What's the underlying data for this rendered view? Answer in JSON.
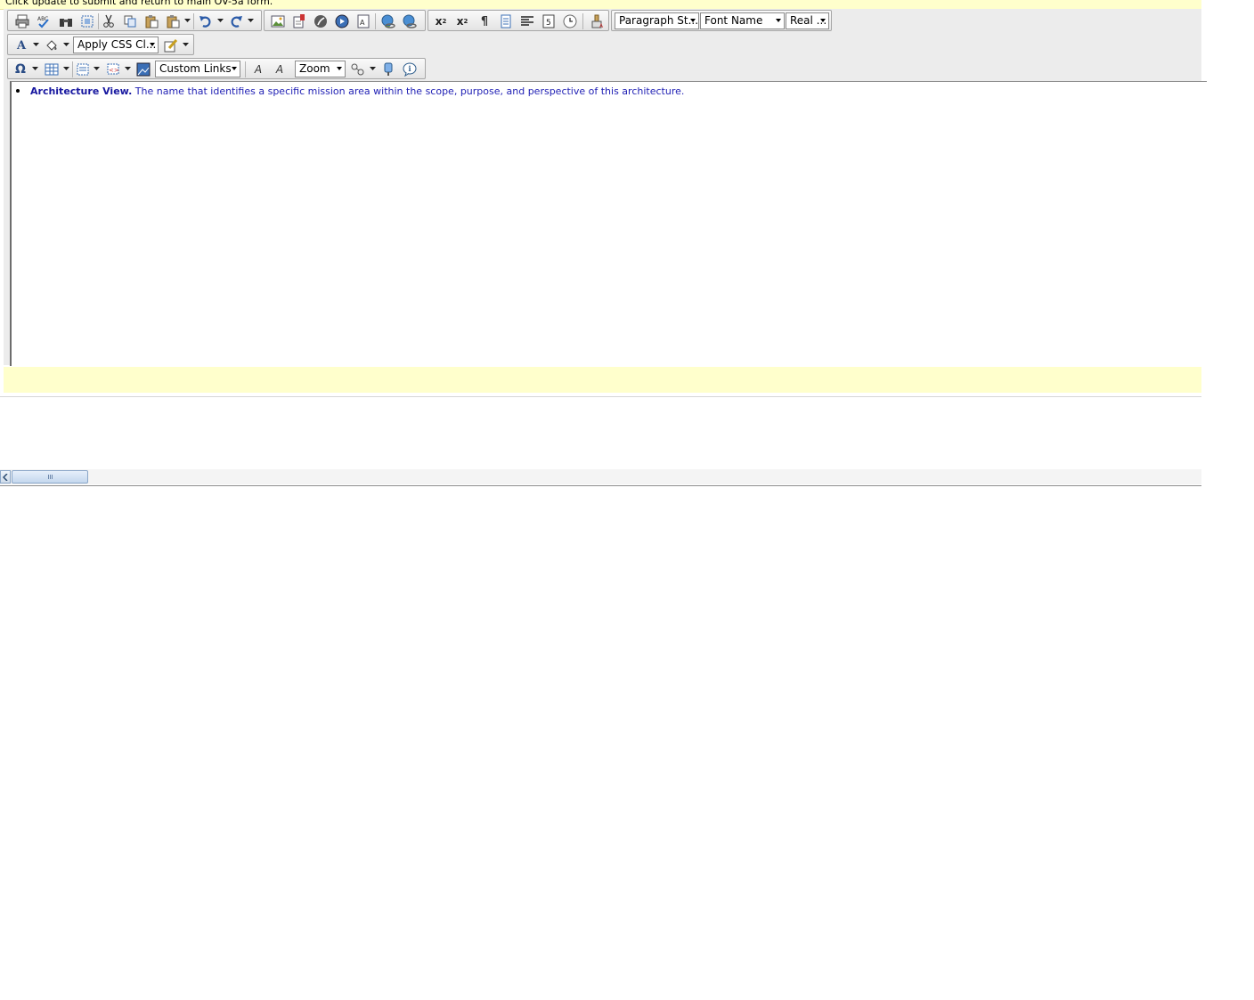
{
  "notice": {
    "text": "Click update to submit and return to main OV-5a form."
  },
  "toolbar": {
    "row1": {
      "paragraph_style": "Paragraph St...",
      "font_name": "Font Name",
      "font_size": "Real ..."
    },
    "row2": {
      "css_class": "Apply CSS Cl..."
    },
    "row3": {
      "custom_links": "Custom Links",
      "zoom": "Zoom"
    }
  },
  "document": {
    "items": [
      {
        "term": "Architecture View.",
        "description": "The name that identifies a specific mission area within the scope, purpose, and perspective of this architecture."
      }
    ]
  },
  "colors": {
    "notice_bg": "#ffffcc",
    "link_text": "#1f1fb4",
    "toolbar_bg": "#ececec"
  }
}
